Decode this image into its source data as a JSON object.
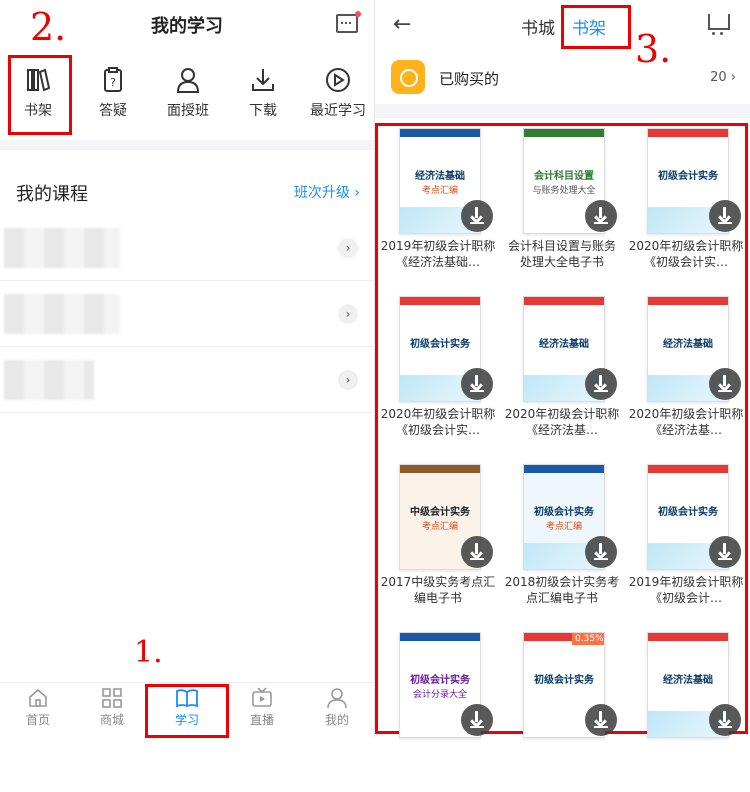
{
  "left": {
    "title": "我的学习",
    "annotation_2": "2.",
    "annotation_1": "1.",
    "shortcuts": [
      {
        "label": "书架",
        "icon": "bookshelf-icon"
      },
      {
        "label": "答疑",
        "icon": "clipboard-question-icon"
      },
      {
        "label": "面授班",
        "icon": "teacher-icon"
      },
      {
        "label": "下载",
        "icon": "download-icon"
      },
      {
        "label": "最近学习",
        "icon": "play-circle-icon"
      }
    ],
    "courses_title": "我的课程",
    "courses_link": "班次升级 ›",
    "tabbar": [
      {
        "label": "首页",
        "icon": "home-icon"
      },
      {
        "label": "商城",
        "icon": "grid-icon"
      },
      {
        "label": "学习",
        "icon": "book-open-icon"
      },
      {
        "label": "直播",
        "icon": "tv-icon"
      },
      {
        "label": "我的",
        "icon": "user-icon"
      }
    ]
  },
  "right": {
    "back_icon": "←",
    "tab_shop": "书城",
    "tab_shelf": "书架",
    "annotation_3": "3.",
    "bought_label": "已购买的",
    "bought_count": "20",
    "bought_chevron": "›",
    "books": [
      {
        "name": "2019年初级会计职称《经济法基础…",
        "cover_title": "经济法基础",
        "cover_sub": "考点汇编"
      },
      {
        "name": "会计科目设置与账务处理大全电子书",
        "cover_title": "会计科目设置",
        "cover_sub": "与账务处理大全"
      },
      {
        "name": "2020年初级会计职称《初级会计实…",
        "cover_title": "初级会计实务",
        "cover_sub": ""
      },
      {
        "name": "2020年初级会计职称《初级会计实…",
        "cover_title": "初级会计实务",
        "cover_sub": ""
      },
      {
        "name": "2020年初级会计职称《经济法基…",
        "cover_title": "经济法基础",
        "cover_sub": ""
      },
      {
        "name": "2020年初级会计职称《经济法基…",
        "cover_title": "经济法基础",
        "cover_sub": ""
      },
      {
        "name": "2017中级实务考点汇编电子书",
        "cover_title": "中级会计实务",
        "cover_sub": "考点汇编"
      },
      {
        "name": "2018初级会计实务考点汇编电子书",
        "cover_title": "初级会计实务",
        "cover_sub": "考点汇编"
      },
      {
        "name": "2019年初级会计职称《初级会计…",
        "cover_title": "初级会计实务",
        "cover_sub": ""
      },
      {
        "name": "",
        "cover_title": "初级会计实务",
        "cover_sub": "会计分录大全"
      },
      {
        "name": "",
        "cover_title": "初级会计实务",
        "cover_sub": "0.35%"
      },
      {
        "name": "",
        "cover_title": "经济法基础",
        "cover_sub": ""
      }
    ]
  }
}
